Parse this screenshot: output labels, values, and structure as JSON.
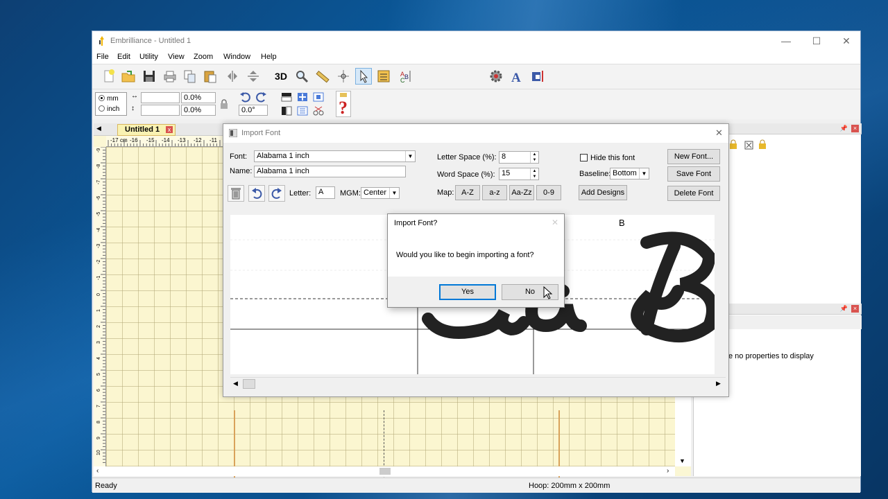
{
  "app": {
    "title": "Embrilliance - Untitled 1",
    "minimize": "—",
    "maximize": "☐",
    "close": "✕"
  },
  "menu": [
    "File",
    "Edit",
    "Utility",
    "View",
    "Zoom",
    "Window",
    "Help"
  ],
  "toolbar": {
    "three_d": "3D"
  },
  "props_toolbar": {
    "unit_mm": "mm",
    "unit_inch": "inch",
    "width_value": "",
    "height_value": "",
    "width_pct": "0.0%",
    "height_pct": "0.0%",
    "rotation": "0.0°"
  },
  "document_tab": {
    "label": "Untitled 1",
    "close": "x"
  },
  "ruler": {
    "top_labels": [
      "-17",
      "cm",
      "-16",
      "-15",
      "-14",
      "-13",
      "-12",
      "-11"
    ],
    "left_labels": [
      "-9",
      "-8",
      "-7",
      "-6",
      "-5",
      "-4",
      "-3",
      "-2",
      "-1",
      "0",
      "1",
      "2",
      "3",
      "4",
      "5",
      "6",
      "7",
      "8",
      "9",
      "10"
    ]
  },
  "status": {
    "left": "Ready",
    "hoop": "Hoop: 200mm x 200mm"
  },
  "properties_panel": {
    "empty_text": "e no properties to display"
  },
  "import_font": {
    "title": "Import Font",
    "font_label": "Font:",
    "font_value": "Alabama 1 inch",
    "name_label": "Name:",
    "name_value": "Alabama 1 inch",
    "letter_label": "Letter:",
    "letter_value": "A",
    "mgm_label": "MGM:",
    "mgm_value": "Center",
    "letter_space_label": "Letter Space (%):",
    "letter_space_value": "8",
    "word_space_label": "Word Space (%):",
    "word_space_value": "15",
    "map_label": "Map:",
    "map_buttons": [
      "A-Z",
      "a-z",
      "Aa-Zz",
      "0-9"
    ],
    "add_designs": "Add Designs",
    "hide_font": "Hide this font",
    "baseline_label": "Baseline:",
    "baseline_value": "Bottom",
    "new_font": "New Font...",
    "save_font": "Save Font",
    "delete_font": "Delete Font",
    "preview_letter_label": "B"
  },
  "confirm": {
    "title": "Import Font?",
    "message": "Would you like to begin importing a font?",
    "yes": "Yes",
    "no": "No"
  }
}
